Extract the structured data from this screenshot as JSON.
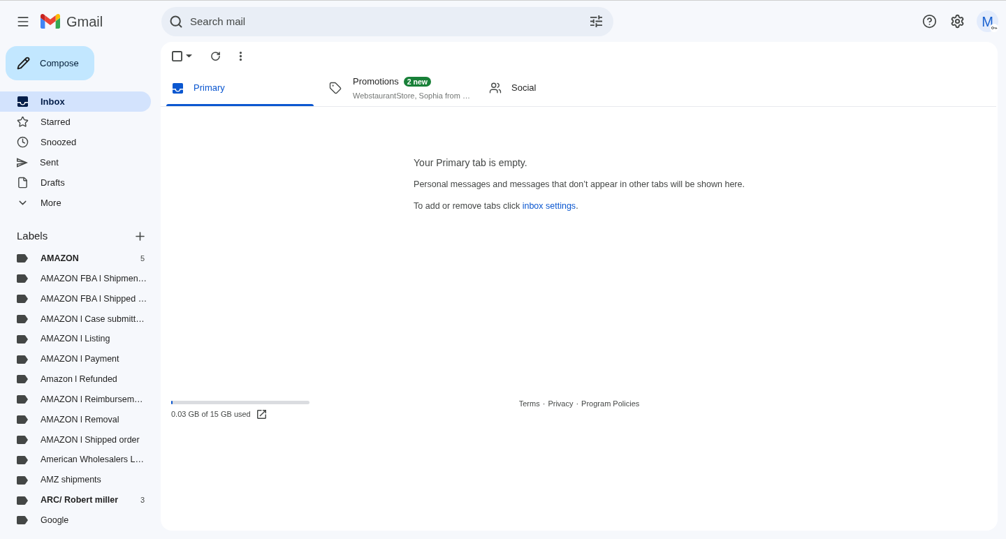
{
  "header": {
    "product_name": "Gmail",
    "search": {
      "placeholder": "Search mail"
    },
    "account": {
      "initial": "M"
    }
  },
  "compose": {
    "label": "Compose"
  },
  "nav": [
    {
      "label": "Inbox",
      "selected": true
    },
    {
      "label": "Starred",
      "selected": false
    },
    {
      "label": "Snoozed",
      "selected": false
    },
    {
      "label": "Sent",
      "selected": false
    },
    {
      "label": "Drafts",
      "selected": false
    },
    {
      "label": "More",
      "selected": false
    }
  ],
  "labels": {
    "title": "Labels",
    "items": [
      {
        "name": "AMAZON",
        "unread": true,
        "count": "5"
      },
      {
        "name": "AMAZON FBA l Shipmen…",
        "unread": false
      },
      {
        "name": "AMAZON FBA l Shipped …",
        "unread": false
      },
      {
        "name": "AMAZON l Case submitt…",
        "unread": false
      },
      {
        "name": "AMAZON l Listing",
        "unread": false
      },
      {
        "name": "AMAZON l Payment",
        "unread": false
      },
      {
        "name": "Amazon l Refunded",
        "unread": false
      },
      {
        "name": "AMAZON l Reimbursem…",
        "unread": false
      },
      {
        "name": "AMAZON l Removal",
        "unread": false
      },
      {
        "name": "AMAZON l Shipped order",
        "unread": false
      },
      {
        "name": "American Wholesalers L…",
        "unread": false
      },
      {
        "name": "AMZ shipments",
        "unread": false
      },
      {
        "name": "ARC/ Robert miller",
        "unread": true,
        "count": "3"
      },
      {
        "name": "Google",
        "unread": false
      }
    ]
  },
  "toolbar": {
    "select_all": {
      "checked": false
    }
  },
  "tabs": [
    {
      "label": "Primary",
      "selected": true
    },
    {
      "label": "Promotions",
      "selected": false,
      "badge": "2 new",
      "preview": "WebstaurantStore, Sophia from …"
    },
    {
      "label": "Social",
      "selected": false
    }
  ],
  "empty_state": {
    "title": "Your Primary tab is empty.",
    "message": "Personal messages and messages that don’t appear in other tabs will be shown here.",
    "hint": {
      "text": "To add or remove tabs click",
      "link": "inbox settings",
      "end": "."
    }
  },
  "storage": {
    "level": 0.002,
    "text": "0.03 GB of 15 GB used"
  },
  "footer_links": [
    {
      "label": "Terms"
    },
    {
      "separator": "·",
      "label": "Privacy"
    },
    {
      "separator": "·",
      "label": "Program Policies"
    }
  ]
}
